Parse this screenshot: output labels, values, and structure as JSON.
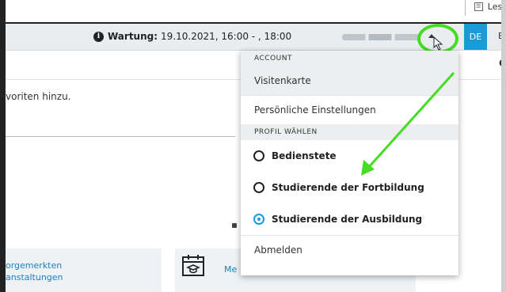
{
  "top": {
    "reader_label": "Lese"
  },
  "header": {
    "info_icon": "info-icon",
    "maintenance_label": "Wartung:",
    "maintenance_text": "19.10.2021, 16:00 - , 18:00",
    "lang_active": "DE",
    "lang_next": "E"
  },
  "subbar": {
    "partial_text": "C"
  },
  "content": {
    "favorites_text": "voriten hinzu.",
    "card1_text": "orgemerkten\nanstaltungen",
    "card2_text": "Me"
  },
  "dropdown": {
    "account_header": "ACCOUNT",
    "business_card": "Visitenkarte",
    "personal_settings": "Persönliche Einstellungen",
    "profile_header": "PROFIL WÄHLEN",
    "profiles": [
      {
        "label": "Bedienstete",
        "selected": false
      },
      {
        "label": "Studierende der Fortbildung",
        "selected": false
      },
      {
        "label": "Studierende der Ausbildung",
        "selected": true
      }
    ],
    "logout": "Abmelden"
  },
  "colors": {
    "accent": "#1a9bd7",
    "annotation": "#44dd22"
  }
}
